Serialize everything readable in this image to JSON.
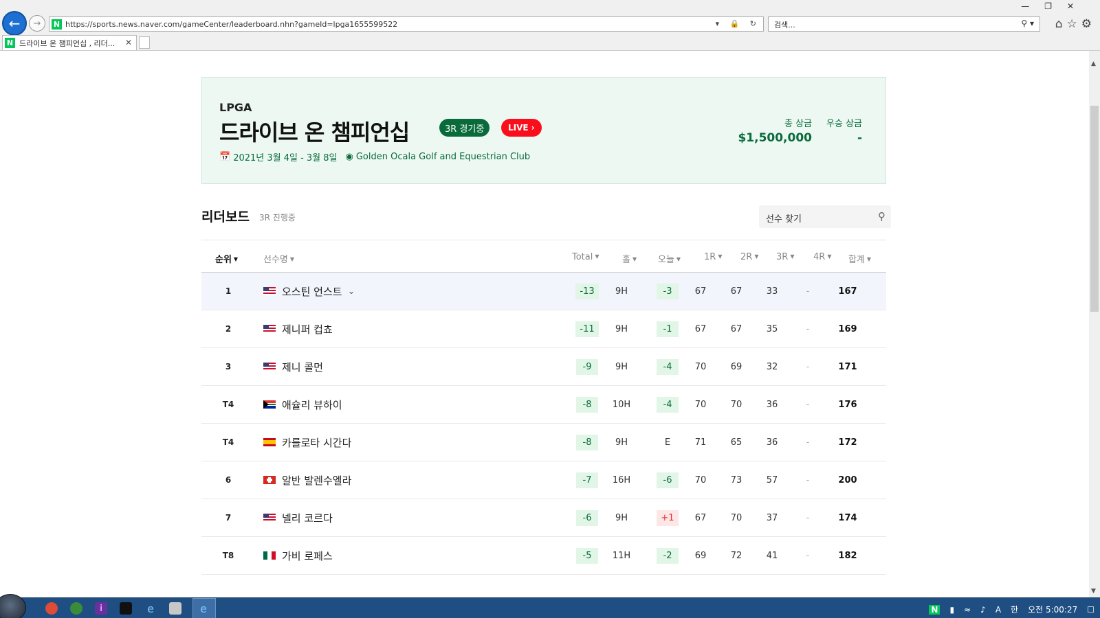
{
  "browser": {
    "url": "https://sports.news.naver.com/gameCenter/leaderboard.nhn?gameId=lpga1655599522",
    "search_placeholder": "검색...",
    "tab_title": "드라이브 온 챔피언십 , 리더...",
    "favicon_letter": "N"
  },
  "game": {
    "league": "LPGA",
    "title": "드라이브 온 챔피언십",
    "round_badge": "3R 경기중",
    "live_badge": "LIVE",
    "dates": "2021년 3월 4일 - 3월 8일",
    "venue": "Golden Ocala Golf and Equestrian Club",
    "total_prize_label": "총 상금",
    "total_prize": "$1,500,000",
    "winner_prize_label": "우승 상금",
    "winner_prize": "-"
  },
  "leaderboard": {
    "title": "리더보드",
    "status": "3R 진행중",
    "search_placeholder": "선수 찾기",
    "columns": [
      "순위",
      "선수명",
      "Total",
      "홀",
      "오늘",
      "1R",
      "2R",
      "3R",
      "4R",
      "합계"
    ],
    "rows": [
      {
        "rank": "1",
        "flag": "us",
        "name": "오스틴 언스트",
        "total": "-13",
        "hole": "9H",
        "today": "-3",
        "r1": "67",
        "r2": "67",
        "r3": "33",
        "r4": "-",
        "sum": "167"
      },
      {
        "rank": "2",
        "flag": "us",
        "name": "제니퍼 컵쵸",
        "total": "-11",
        "hole": "9H",
        "today": "-1",
        "r1": "67",
        "r2": "67",
        "r3": "35",
        "r4": "-",
        "sum": "169"
      },
      {
        "rank": "3",
        "flag": "us",
        "name": "제니 콜먼",
        "total": "-9",
        "hole": "9H",
        "today": "-4",
        "r1": "70",
        "r2": "69",
        "r3": "32",
        "r4": "-",
        "sum": "171"
      },
      {
        "rank": "T4",
        "flag": "za",
        "name": "애슐리 뷰하이",
        "total": "-8",
        "hole": "10H",
        "today": "-4",
        "r1": "70",
        "r2": "70",
        "r3": "36",
        "r4": "-",
        "sum": "176"
      },
      {
        "rank": "T4",
        "flag": "es",
        "name": "카를로타 시간다",
        "total": "-8",
        "hole": "9H",
        "today": "E",
        "r1": "71",
        "r2": "65",
        "r3": "36",
        "r4": "-",
        "sum": "172"
      },
      {
        "rank": "6",
        "flag": "ch",
        "name": "알반 발렌수엘라",
        "total": "-7",
        "hole": "16H",
        "today": "-6",
        "r1": "70",
        "r2": "73",
        "r3": "57",
        "r4": "-",
        "sum": "200"
      },
      {
        "rank": "7",
        "flag": "us",
        "name": "넬리 코르다",
        "total": "-6",
        "hole": "9H",
        "today": "+1",
        "r1": "67",
        "r2": "70",
        "r3": "37",
        "r4": "-",
        "sum": "174"
      },
      {
        "rank": "T8",
        "flag": "mx",
        "name": "가비 로페스",
        "total": "-5",
        "hole": "11H",
        "today": "-2",
        "r1": "69",
        "r2": "72",
        "r3": "41",
        "r4": "-",
        "sum": "182"
      }
    ]
  },
  "taskbar": {
    "time": "오전 5:00:27",
    "ime": "A",
    "lang": "한"
  },
  "colors": {
    "accent_green": "#0a6b3b",
    "live_red": "#fa0e1b",
    "card_bg": "#edf8f3"
  }
}
